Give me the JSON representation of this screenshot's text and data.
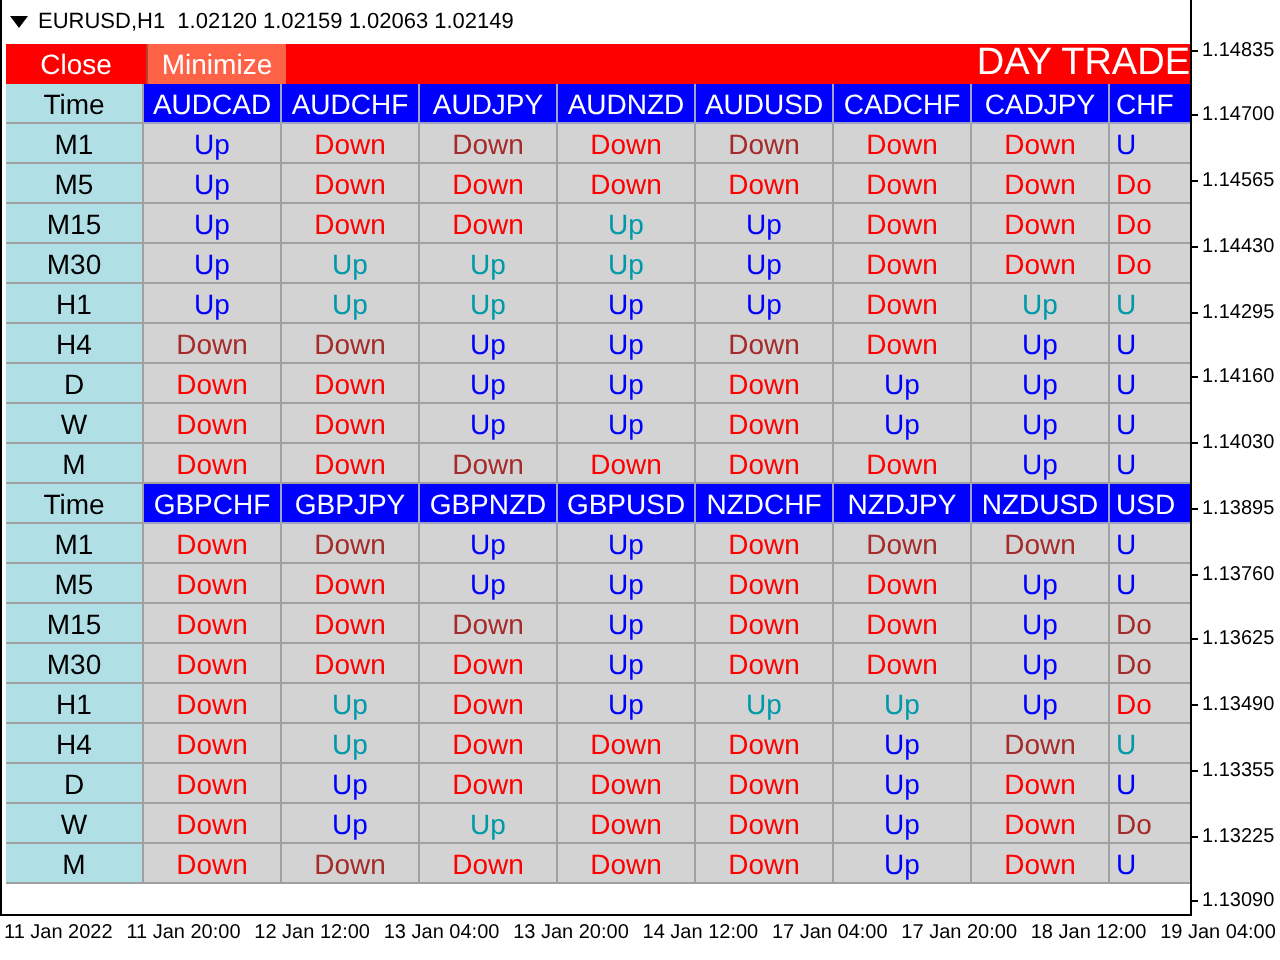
{
  "chart": {
    "title": "EURUSD,H1  1.02120 1.02159 1.02063 1.02149",
    "price_labels": [
      "1.14835",
      "1.14700",
      "1.14565",
      "1.14430",
      "1.14295",
      "1.14160",
      "1.14030",
      "1.13895",
      "1.13760",
      "1.13625",
      "1.13490",
      "1.13355",
      "1.13225",
      "1.13090"
    ],
    "time_labels": [
      "11 Jan 2022",
      "11 Jan 20:00",
      "12 Jan 12:00",
      "13 Jan 04:00",
      "13 Jan 20:00",
      "14 Jan 12:00",
      "17 Jan 04:00",
      "17 Jan 20:00",
      "18 Jan 12:00",
      "19 Jan 04:00"
    ]
  },
  "panel": {
    "close_button": "Close",
    "minimize_button": "Minimize",
    "banner": "DAY TRADE",
    "blocks": [
      {
        "time_header": "Time",
        "pairs": [
          "AUDCAD",
          "AUDCHF",
          "AUDJPY",
          "AUDNZD",
          "AUDUSD",
          "CADCHF",
          "CADJPY",
          "CHF"
        ],
        "rows": [
          {
            "timeframe": "M1",
            "cells": [
              {
                "text": "Up",
                "color": "#0000ff"
              },
              {
                "text": "Down",
                "color": "#ff0000"
              },
              {
                "text": "Down",
                "color": "#a52a2a"
              },
              {
                "text": "Down",
                "color": "#ff0000"
              },
              {
                "text": "Down",
                "color": "#a52a2a"
              },
              {
                "text": "Down",
                "color": "#ff0000"
              },
              {
                "text": "Down",
                "color": "#ff0000"
              },
              {
                "text": "U",
                "color": "#0000ff"
              }
            ]
          },
          {
            "timeframe": "M5",
            "cells": [
              {
                "text": "Up",
                "color": "#0000ff"
              },
              {
                "text": "Down",
                "color": "#ff0000"
              },
              {
                "text": "Down",
                "color": "#ff0000"
              },
              {
                "text": "Down",
                "color": "#ff0000"
              },
              {
                "text": "Down",
                "color": "#ff0000"
              },
              {
                "text": "Down",
                "color": "#ff0000"
              },
              {
                "text": "Down",
                "color": "#ff0000"
              },
              {
                "text": "Do",
                "color": "#ff0000"
              }
            ]
          },
          {
            "timeframe": "M15",
            "cells": [
              {
                "text": "Up",
                "color": "#0000ff"
              },
              {
                "text": "Down",
                "color": "#ff0000"
              },
              {
                "text": "Down",
                "color": "#ff0000"
              },
              {
                "text": "Up",
                "color": "#0099a8"
              },
              {
                "text": "Up",
                "color": "#0000ff"
              },
              {
                "text": "Down",
                "color": "#ff0000"
              },
              {
                "text": "Down",
                "color": "#ff0000"
              },
              {
                "text": "Do",
                "color": "#ff0000"
              }
            ]
          },
          {
            "timeframe": "M30",
            "cells": [
              {
                "text": "Up",
                "color": "#0000ff"
              },
              {
                "text": "Up",
                "color": "#0099a8"
              },
              {
                "text": "Up",
                "color": "#0099a8"
              },
              {
                "text": "Up",
                "color": "#0099a8"
              },
              {
                "text": "Up",
                "color": "#0000ff"
              },
              {
                "text": "Down",
                "color": "#ff0000"
              },
              {
                "text": "Down",
                "color": "#ff0000"
              },
              {
                "text": "Do",
                "color": "#ff0000"
              }
            ]
          },
          {
            "timeframe": "H1",
            "cells": [
              {
                "text": "Up",
                "color": "#0000ff"
              },
              {
                "text": "Up",
                "color": "#0099a8"
              },
              {
                "text": "Up",
                "color": "#0099a8"
              },
              {
                "text": "Up",
                "color": "#0000ff"
              },
              {
                "text": "Up",
                "color": "#0000ff"
              },
              {
                "text": "Down",
                "color": "#ff0000"
              },
              {
                "text": "Up",
                "color": "#0099a8"
              },
              {
                "text": "U",
                "color": "#0099a8"
              }
            ]
          },
          {
            "timeframe": "H4",
            "cells": [
              {
                "text": "Down",
                "color": "#a52a2a"
              },
              {
                "text": "Down",
                "color": "#a52a2a"
              },
              {
                "text": "Up",
                "color": "#0000ff"
              },
              {
                "text": "Up",
                "color": "#0000ff"
              },
              {
                "text": "Down",
                "color": "#a52a2a"
              },
              {
                "text": "Down",
                "color": "#ff0000"
              },
              {
                "text": "Up",
                "color": "#0000ff"
              },
              {
                "text": "U",
                "color": "#0000ff"
              }
            ]
          },
          {
            "timeframe": "D",
            "cells": [
              {
                "text": "Down",
                "color": "#ff0000"
              },
              {
                "text": "Down",
                "color": "#ff0000"
              },
              {
                "text": "Up",
                "color": "#0000ff"
              },
              {
                "text": "Up",
                "color": "#0000ff"
              },
              {
                "text": "Down",
                "color": "#ff0000"
              },
              {
                "text": "Up",
                "color": "#0000ff"
              },
              {
                "text": "Up",
                "color": "#0000ff"
              },
              {
                "text": "U",
                "color": "#0000ff"
              }
            ]
          },
          {
            "timeframe": "W",
            "cells": [
              {
                "text": "Down",
                "color": "#ff0000"
              },
              {
                "text": "Down",
                "color": "#ff0000"
              },
              {
                "text": "Up",
                "color": "#0000ff"
              },
              {
                "text": "Up",
                "color": "#0000ff"
              },
              {
                "text": "Down",
                "color": "#ff0000"
              },
              {
                "text": "Up",
                "color": "#0000ff"
              },
              {
                "text": "Up",
                "color": "#0000ff"
              },
              {
                "text": "U",
                "color": "#0000ff"
              }
            ]
          },
          {
            "timeframe": "M",
            "cells": [
              {
                "text": "Down",
                "color": "#ff0000"
              },
              {
                "text": "Down",
                "color": "#ff0000"
              },
              {
                "text": "Down",
                "color": "#a52a2a"
              },
              {
                "text": "Down",
                "color": "#ff0000"
              },
              {
                "text": "Down",
                "color": "#ff0000"
              },
              {
                "text": "Down",
                "color": "#ff0000"
              },
              {
                "text": "Up",
                "color": "#0000ff"
              },
              {
                "text": "U",
                "color": "#0000ff"
              }
            ]
          }
        ]
      },
      {
        "time_header": "Time",
        "pairs": [
          "GBPCHF",
          "GBPJPY",
          "GBPNZD",
          "GBPUSD",
          "NZDCHF",
          "NZDJPY",
          "NZDUSD",
          "USD"
        ],
        "rows": [
          {
            "timeframe": "M1",
            "cells": [
              {
                "text": "Down",
                "color": "#ff0000"
              },
              {
                "text": "Down",
                "color": "#a52a2a"
              },
              {
                "text": "Up",
                "color": "#0000ff"
              },
              {
                "text": "Up",
                "color": "#0000ff"
              },
              {
                "text": "Down",
                "color": "#ff0000"
              },
              {
                "text": "Down",
                "color": "#a52a2a"
              },
              {
                "text": "Down",
                "color": "#a52a2a"
              },
              {
                "text": "U",
                "color": "#0000ff"
              }
            ]
          },
          {
            "timeframe": "M5",
            "cells": [
              {
                "text": "Down",
                "color": "#ff0000"
              },
              {
                "text": "Down",
                "color": "#ff0000"
              },
              {
                "text": "Up",
                "color": "#0000ff"
              },
              {
                "text": "Up",
                "color": "#0000ff"
              },
              {
                "text": "Down",
                "color": "#ff0000"
              },
              {
                "text": "Down",
                "color": "#ff0000"
              },
              {
                "text": "Up",
                "color": "#0000ff"
              },
              {
                "text": "U",
                "color": "#0000ff"
              }
            ]
          },
          {
            "timeframe": "M15",
            "cells": [
              {
                "text": "Down",
                "color": "#ff0000"
              },
              {
                "text": "Down",
                "color": "#ff0000"
              },
              {
                "text": "Down",
                "color": "#a52a2a"
              },
              {
                "text": "Up",
                "color": "#0000ff"
              },
              {
                "text": "Down",
                "color": "#ff0000"
              },
              {
                "text": "Down",
                "color": "#ff0000"
              },
              {
                "text": "Up",
                "color": "#0000ff"
              },
              {
                "text": "Do",
                "color": "#a52a2a"
              }
            ]
          },
          {
            "timeframe": "M30",
            "cells": [
              {
                "text": "Down",
                "color": "#ff0000"
              },
              {
                "text": "Down",
                "color": "#ff0000"
              },
              {
                "text": "Down",
                "color": "#ff0000"
              },
              {
                "text": "Up",
                "color": "#0000ff"
              },
              {
                "text": "Down",
                "color": "#ff0000"
              },
              {
                "text": "Down",
                "color": "#ff0000"
              },
              {
                "text": "Up",
                "color": "#0000ff"
              },
              {
                "text": "Do",
                "color": "#a52a2a"
              }
            ]
          },
          {
            "timeframe": "H1",
            "cells": [
              {
                "text": "Down",
                "color": "#ff0000"
              },
              {
                "text": "Up",
                "color": "#0099a8"
              },
              {
                "text": "Down",
                "color": "#ff0000"
              },
              {
                "text": "Up",
                "color": "#0000ff"
              },
              {
                "text": "Up",
                "color": "#0099a8"
              },
              {
                "text": "Up",
                "color": "#0099a8"
              },
              {
                "text": "Up",
                "color": "#0000ff"
              },
              {
                "text": "Do",
                "color": "#ff0000"
              }
            ]
          },
          {
            "timeframe": "H4",
            "cells": [
              {
                "text": "Down",
                "color": "#ff0000"
              },
              {
                "text": "Up",
                "color": "#0099a8"
              },
              {
                "text": "Down",
                "color": "#ff0000"
              },
              {
                "text": "Down",
                "color": "#ff0000"
              },
              {
                "text": "Down",
                "color": "#ff0000"
              },
              {
                "text": "Up",
                "color": "#0000ff"
              },
              {
                "text": "Down",
                "color": "#a52a2a"
              },
              {
                "text": "U",
                "color": "#0099a8"
              }
            ]
          },
          {
            "timeframe": "D",
            "cells": [
              {
                "text": "Down",
                "color": "#ff0000"
              },
              {
                "text": "Up",
                "color": "#0000ff"
              },
              {
                "text": "Down",
                "color": "#ff0000"
              },
              {
                "text": "Down",
                "color": "#ff0000"
              },
              {
                "text": "Down",
                "color": "#ff0000"
              },
              {
                "text": "Up",
                "color": "#0000ff"
              },
              {
                "text": "Down",
                "color": "#ff0000"
              },
              {
                "text": "U",
                "color": "#0000ff"
              }
            ]
          },
          {
            "timeframe": "W",
            "cells": [
              {
                "text": "Down",
                "color": "#ff0000"
              },
              {
                "text": "Up",
                "color": "#0000ff"
              },
              {
                "text": "Up",
                "color": "#0099a8"
              },
              {
                "text": "Down",
                "color": "#ff0000"
              },
              {
                "text": "Down",
                "color": "#ff0000"
              },
              {
                "text": "Up",
                "color": "#0000ff"
              },
              {
                "text": "Down",
                "color": "#ff0000"
              },
              {
                "text": "Do",
                "color": "#a52a2a"
              }
            ]
          },
          {
            "timeframe": "M",
            "cells": [
              {
                "text": "Down",
                "color": "#ff0000"
              },
              {
                "text": "Down",
                "color": "#a52a2a"
              },
              {
                "text": "Down",
                "color": "#ff0000"
              },
              {
                "text": "Down",
                "color": "#ff0000"
              },
              {
                "text": "Down",
                "color": "#ff0000"
              },
              {
                "text": "Up",
                "color": "#0000ff"
              },
              {
                "text": "Down",
                "color": "#ff0000"
              },
              {
                "text": "U",
                "color": "#0000ff"
              }
            ]
          }
        ]
      }
    ]
  }
}
